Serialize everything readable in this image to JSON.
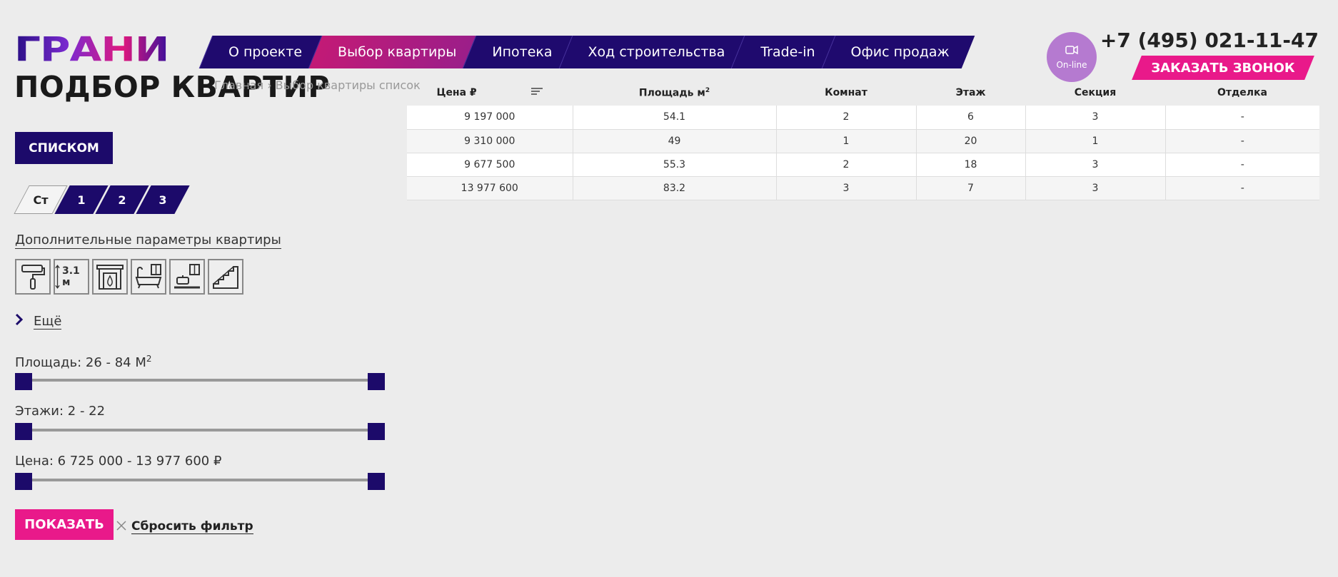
{
  "logo": {
    "text": "ГРАНИ"
  },
  "nav": {
    "items": [
      {
        "label": "О проекте"
      },
      {
        "label": "Выбор квартиры",
        "active": true
      },
      {
        "label": "Ипотека"
      },
      {
        "label": "Ход строительства"
      },
      {
        "label": "Trade-in"
      },
      {
        "label": "Офис продаж"
      }
    ]
  },
  "header": {
    "online_label": "On-line",
    "phone": "+7 (495) 021-11-47",
    "callback_label": "ЗАКАЗАТЬ ЗВОНОК"
  },
  "page": {
    "title": "ПОДБОР КВАРТИР",
    "breadcrumb": "Главная › Выбор квартиры список"
  },
  "filters": {
    "list_button": "СПИСКОМ",
    "rooms": [
      "Ст",
      "1",
      "2",
      "3"
    ],
    "extra_params_label": "Дополнительные параметры квартиры",
    "ceiling_label": "3.1 м",
    "more_label": "Ещё",
    "area_label": "Площадь: 26 - 84 М",
    "area_sup": "2",
    "floors_label": "Этажи: 2 - 22",
    "price_label": "Цена: 6 725 000 - 13 977 600 ₽",
    "show_button": "ПОКАЗАТЬ",
    "reset_label": "Сбросить фильтр"
  },
  "table": {
    "headers": {
      "price": "Цена ₽",
      "area": "Площадь м",
      "area_sup": "2",
      "rooms": "Комнат",
      "floor": "Этаж",
      "section": "Секция",
      "finish": "Отделка"
    },
    "rows": [
      {
        "price": "9 197 000",
        "area": "54.1",
        "rooms": "2",
        "floor": "6",
        "section": "3",
        "finish": "-"
      },
      {
        "price": "9 310 000",
        "area": "49",
        "rooms": "1",
        "floor": "20",
        "section": "1",
        "finish": "-"
      },
      {
        "price": "9 677 500",
        "area": "55.3",
        "rooms": "2",
        "floor": "18",
        "section": "3",
        "finish": "-"
      },
      {
        "price": "13 977 600",
        "area": "83.2",
        "rooms": "3",
        "floor": "7",
        "section": "3",
        "finish": "-"
      }
    ]
  },
  "colors": {
    "primary": "#1c0a6a",
    "accent": "#e9198a",
    "online": "#b57ad0"
  }
}
